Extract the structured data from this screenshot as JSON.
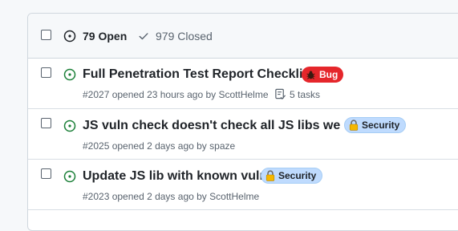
{
  "header": {
    "open_count_label": "79 Open",
    "closed_count_label": "979 Closed"
  },
  "issues": [
    {
      "title": "Full Penetration Test Report Checklist",
      "label": {
        "text": "Bug",
        "icon": "bug-emoji-icon",
        "color": "#e5262b"
      },
      "meta_prefix": "#2027 opened 23 hours ago by",
      "author": "ScottHelme",
      "tasks": "5 tasks"
    },
    {
      "title": "JS vuln check doesn't check all JS libs we use",
      "label": {
        "text": "Security",
        "icon": "lock-emoji-icon",
        "color": "#bfdbfe"
      },
      "meta_prefix": "#2025 opened 2 days ago by",
      "author": "spaze"
    },
    {
      "title": "Update JS lib with known vuln",
      "label": {
        "text": "Security",
        "icon": "lock-emoji-icon",
        "color": "#bfdbfe"
      },
      "meta_prefix": "#2023 opened 2 days ago by",
      "author": "ScottHelme"
    }
  ],
  "colors": {
    "open_green": "#1a7f37",
    "border": "#d0d7de",
    "muted": "#59636e"
  }
}
